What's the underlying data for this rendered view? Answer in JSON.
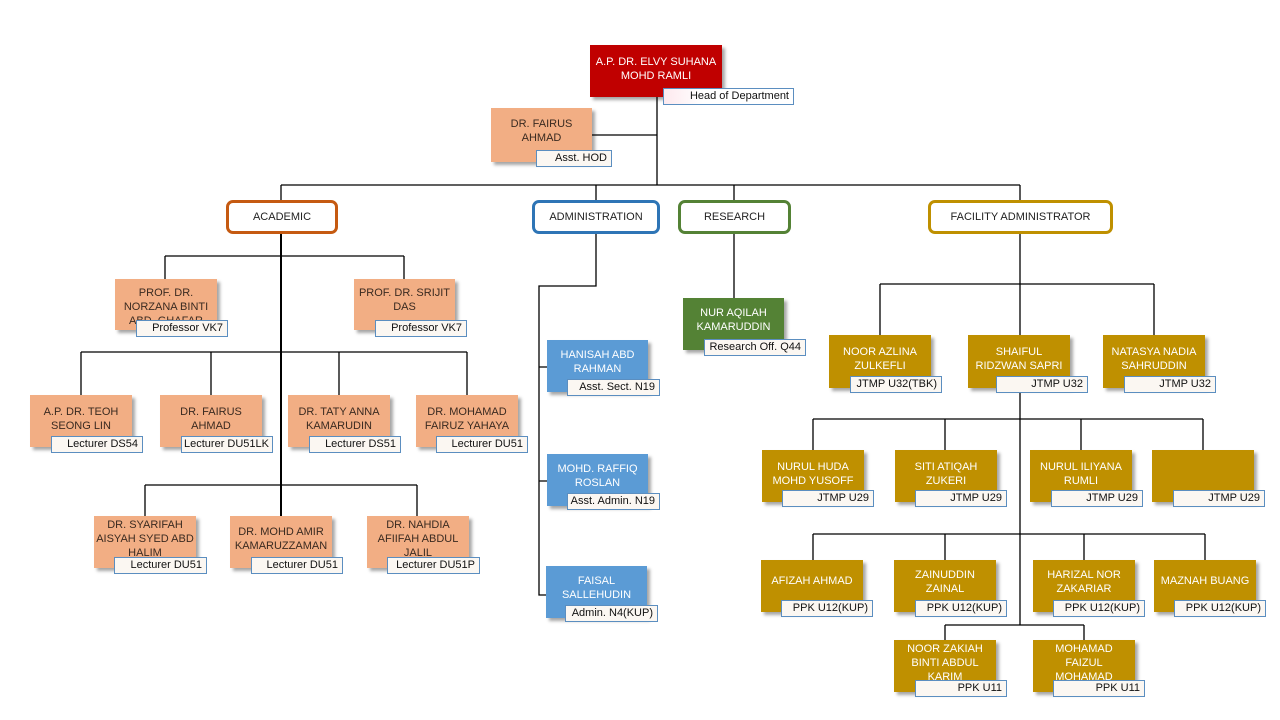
{
  "diagram": {
    "type": "org-chart",
    "colors": {
      "head": "#c00000",
      "academic_staff": "#f2ae84",
      "administration_staff": "#5b9bd5",
      "research_staff": "#548235",
      "facility_staff": "#bf9000",
      "academic_border": "#c55a11",
      "administration_border": "#2e75b6",
      "research_border": "#548235",
      "facility_border": "#bf9000"
    },
    "head": {
      "name": "A.P. DR. ELVY SUHANA\nMOHD RAMLI",
      "title": "Head of Department"
    },
    "assistant_head": {
      "name": "DR. FAIRUS\nAHMAD",
      "title": "Asst. HOD"
    },
    "departments": {
      "academic": "ACADEMIC",
      "administration": "ADMINISTRATION",
      "research": "RESEARCH",
      "facility": "FACILITY ADMINISTRATOR"
    },
    "academic": {
      "professors": [
        {
          "name": "PROF. DR.\nNORZANA  BINTI\nABD. GHAFAR",
          "title": "Professor VK7"
        },
        {
          "name": "PROF. DR. SRIJIT\nDAS",
          "title": "Professor VK7"
        }
      ],
      "lecturers_row1": [
        {
          "name": "A.P. DR. TEOH\nSEONG LIN",
          "title": "Lecturer DS54"
        },
        {
          "name": "DR. FAIRUS\nAHMAD",
          "title": "Lecturer DU51LK"
        },
        {
          "name": "DR. TATY  ANNA\nKAMARUDIN",
          "title": "Lecturer DS51"
        },
        {
          "name": "DR. MOHAMAD\nFAIRUZ YAHAYA",
          "title": "Lecturer DU51"
        }
      ],
      "lecturers_row2": [
        {
          "name": "DR. SYARIFAH\nAISYAH  SYED ABD\nHALIM",
          "title": "Lecturer DU51"
        },
        {
          "name": "DR. MOHD AMIR\nKAMARUZZAMAN",
          "title": "Lecturer DU51"
        },
        {
          "name": "DR. NAHDIA\nAFIIFAH  ABDUL\nJALIL",
          "title": "Lecturer DU51P"
        }
      ]
    },
    "administration": [
      {
        "name": "HANISAH  ABD\nRAHMAN",
        "title": "Asst. Sect. N19"
      },
      {
        "name": "MOHD. RAFFIQ\nROSLAN",
        "title": "Asst. Admin. N19"
      },
      {
        "name": "FAISAL\nSALLEHUDIN",
        "title": "Admin. N4(KUP)"
      }
    ],
    "research": [
      {
        "name": "NUR  AQILAH\nKAMARUDDIN",
        "title": "Research Off. Q44"
      }
    ],
    "facility": {
      "row1": [
        {
          "name": "NOOR AZLINA\nZULKEFLI",
          "title": "JTMP U32(TBK)"
        },
        {
          "name": "SHAIFUL\nRIDZWAN  SAPRI",
          "title": "JTMP U32"
        },
        {
          "name": "NATASYA  NADIA\nSAHRUDDIN",
          "title": "JTMP U32"
        }
      ],
      "row2": [
        {
          "name": "NURUL  HUDA\nMOHD YUSOFF",
          "title": "JTMP U29"
        },
        {
          "name": "SITI ATIQAH\nZUKERI",
          "title": "JTMP U29"
        },
        {
          "name": "NURUL  ILIYANA\nRUMLI",
          "title": "JTMP U29"
        },
        {
          "name": "",
          "title": "JTMP U29"
        }
      ],
      "row3": [
        {
          "name": "AFIZAH  AHMAD",
          "title": "PPK U12(KUP)"
        },
        {
          "name": "ZAINUDDIN\nZAINAL",
          "title": "PPK U12(KUP)"
        },
        {
          "name": "HARIZAL  NOR\nZAKARIAR",
          "title": "PPK U12(KUP)"
        },
        {
          "name": "MAZNAH  BUANG",
          "title": "PPK U12(KUP)"
        }
      ],
      "row4": [
        {
          "name": "NOOR ZAKIAH\nBINTI ABDUL\nKARIM",
          "title": "PPK U11"
        },
        {
          "name": "MOHAMAD\nFAIZUL\nMOHAMAD",
          "title": "PPK U11"
        }
      ]
    }
  }
}
